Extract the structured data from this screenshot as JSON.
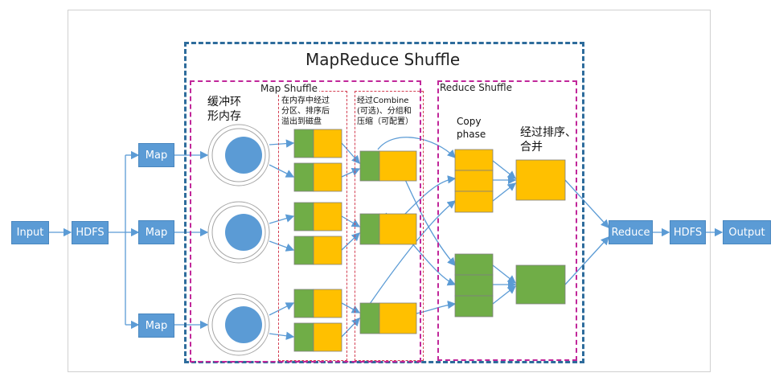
{
  "diagram": {
    "title": "MapReduce Shuffle",
    "map_shuffle_label": "Map Shuffle",
    "reduce_shuffle_label": "Reduce Shuffle",
    "buffer_note": "缓冲环\n形内存",
    "spill_note": "在内存中经过\n分区、排序后\n溢出到磁盘",
    "combine_note": "经过Combine\n(可选)、分组和\n压缩（可配置）",
    "copy_note": "Copy\nphase",
    "merge_note": "经过排序、\n合并",
    "nodes": {
      "input": "Input",
      "hdfs_in": "HDFS",
      "map1": "Map",
      "map2": "Map",
      "map3": "Map",
      "reduce": "Reduce",
      "hdfs_out": "HDFS",
      "output": "Output"
    },
    "colors": {
      "node_blue": "#5b9bd5",
      "green": "#70ad47",
      "yellow": "#ffc000",
      "outer_border": "#2e6c9c",
      "shuffle_border": "#c1279a",
      "stage_border": "#d33f52"
    }
  }
}
